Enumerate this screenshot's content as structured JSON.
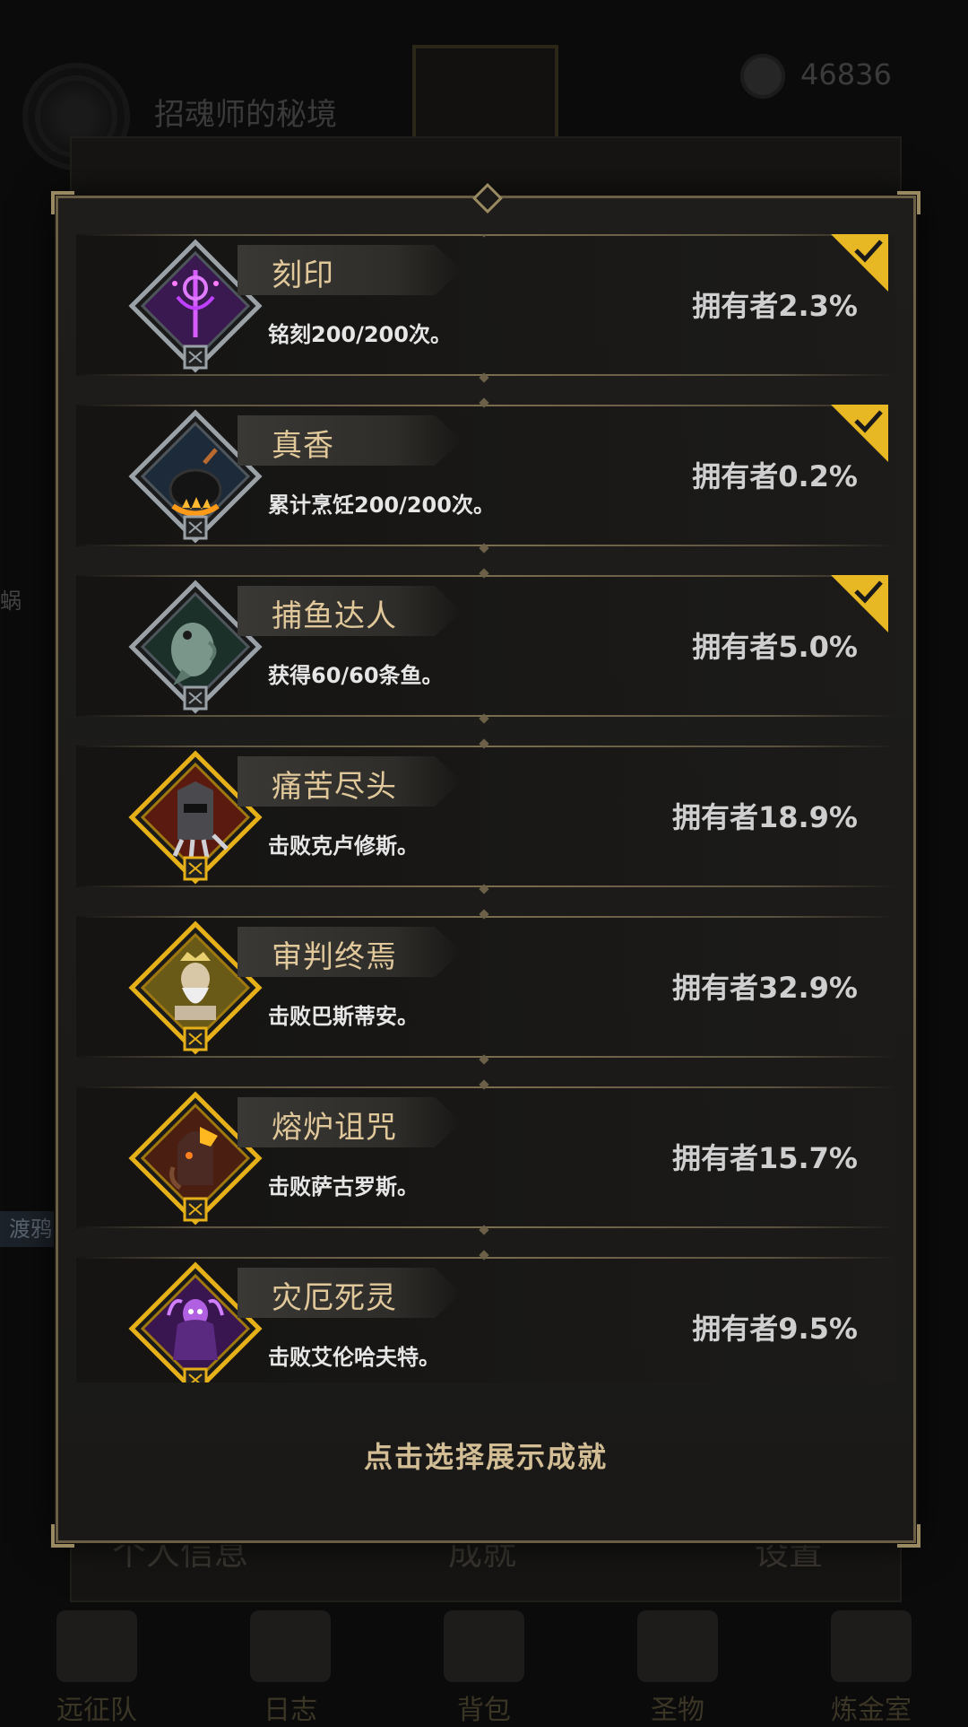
{
  "background": {
    "area_title": "招魂师的秘境",
    "currency_count": "46836",
    "side_text": "蜗",
    "ferry_label": "渡鸦",
    "tabs": [
      "个人信息",
      "成就",
      "设置"
    ],
    "nav": [
      {
        "label": "远征队",
        "icon": "helmet-icon"
      },
      {
        "label": "日志",
        "icon": "scroll-icon"
      },
      {
        "label": "背包",
        "icon": "backpack-icon"
      },
      {
        "label": "圣物",
        "icon": "relic-icon"
      },
      {
        "label": "炼金室",
        "icon": "alchemy-icon"
      }
    ]
  },
  "dialog": {
    "footer_hint": "点击选择展示成就",
    "achievements": [
      {
        "name": "刻印",
        "desc": "铭刻200/200次。",
        "owners": "拥有者2.3%",
        "checked": true,
        "tier": "silver",
        "icon": "rune-staff-icon",
        "theme": "#3a1850"
      },
      {
        "name": "真香",
        "desc": "累计烹饪200/200次。",
        "owners": "拥有者0.2%",
        "checked": true,
        "tier": "silver",
        "icon": "cooking-pot-icon",
        "theme": "#1c2a3a"
      },
      {
        "name": "捕鱼达人",
        "desc": "获得60/60条鱼。",
        "owners": "拥有者5.0%",
        "checked": true,
        "tier": "silver",
        "icon": "fish-icon",
        "theme": "#1a3028"
      },
      {
        "name": "痛苦尽头",
        "desc": "击败克卢修斯。",
        "owners": "拥有者18.9%",
        "checked": false,
        "tier": "gold",
        "icon": "spiked-knight-icon",
        "theme": "#5a1a10"
      },
      {
        "name": "审判终焉",
        "desc": "击败巴斯蒂安。",
        "owners": "拥有者32.9%",
        "checked": false,
        "tier": "gold",
        "icon": "judge-king-icon",
        "theme": "#6a5a18"
      },
      {
        "name": "熔炉诅咒",
        "desc": "击败萨古罗斯。",
        "owners": "拥有者15.7%",
        "checked": false,
        "tier": "gold",
        "icon": "forge-demon-icon",
        "theme": "#4a1e10"
      },
      {
        "name": "灾厄死灵",
        "desc": "击败艾伦哈夫特。",
        "owners": "拥有者9.5%",
        "checked": false,
        "tier": "gold",
        "icon": "death-wraith-icon",
        "theme": "#3a1650"
      }
    ]
  }
}
